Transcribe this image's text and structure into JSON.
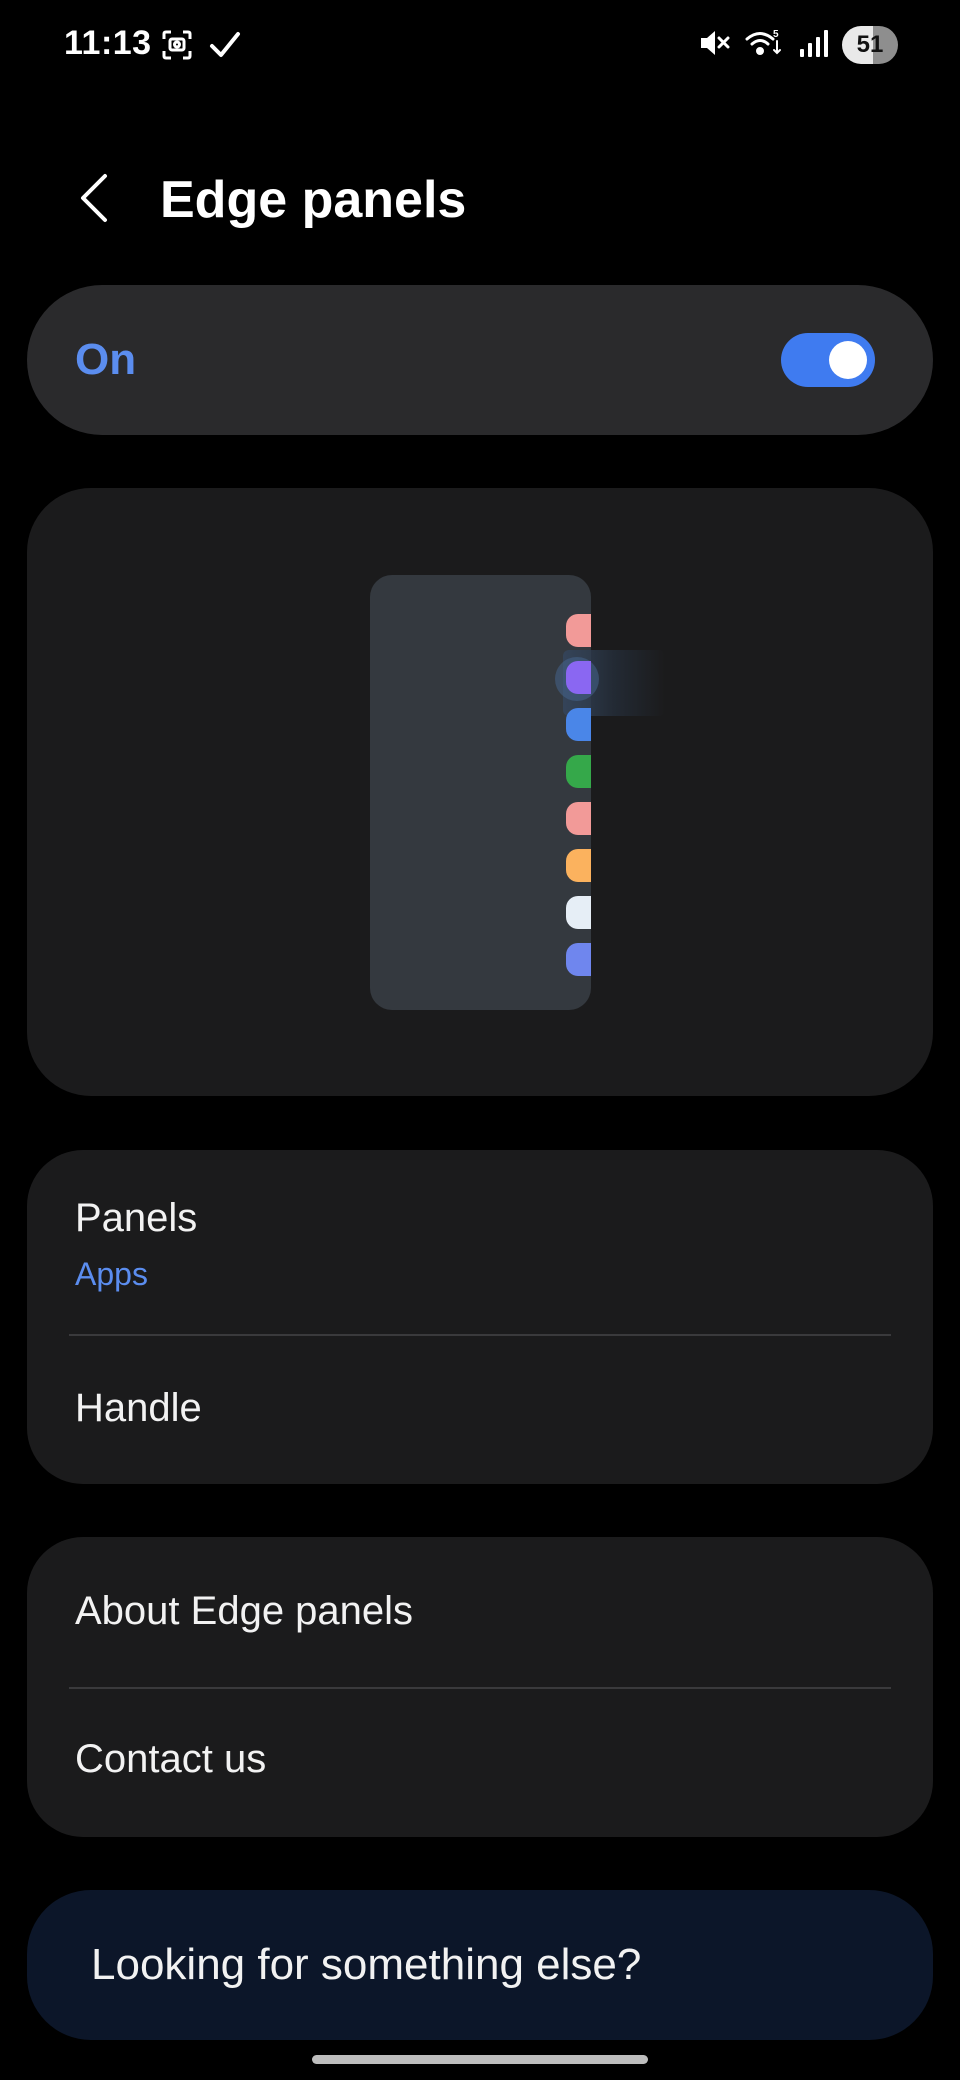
{
  "status_bar": {
    "time": "11:13",
    "left_icons": [
      "screenshot-icon",
      "check-icon"
    ],
    "right_icons": [
      "mute-icon",
      "wifi-icon",
      "signal-icon"
    ],
    "battery": "51"
  },
  "header": {
    "title": "Edge panels",
    "back_icon": "chevron-left-icon"
  },
  "master_switch": {
    "label": "On",
    "enabled": true,
    "accent_color": "#3f7bf0",
    "label_color": "#5b8def"
  },
  "illustration": {
    "tab_colors": [
      "#f29a98",
      "#8a67f2",
      "#4a86e8",
      "#35a84a",
      "#f29a98",
      "#fbb25e",
      "#e6eef6",
      "#6f86ee"
    ],
    "highlighted_tab_index": 1
  },
  "groups": [
    {
      "items": [
        {
          "title": "Panels",
          "subtitle": "Apps"
        },
        {
          "title": "Handle"
        }
      ]
    },
    {
      "items": [
        {
          "title": "About Edge panels"
        },
        {
          "title": "Contact us"
        }
      ]
    }
  ],
  "suggestion": {
    "text": "Looking for something else?"
  },
  "colors": {
    "background": "#000000",
    "card": "#1b1b1c",
    "switch_bar": "#2a2a2c",
    "suggestion_card": "#0c1629"
  }
}
